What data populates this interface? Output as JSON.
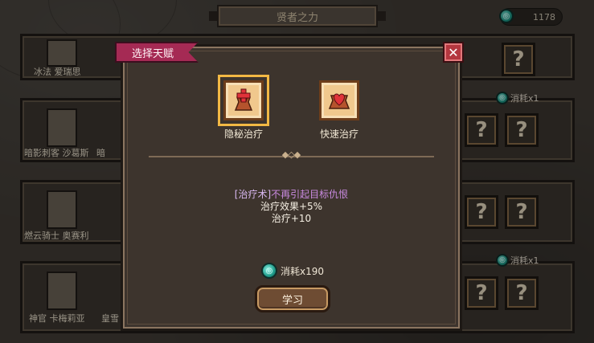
{
  "header": {
    "title": "贤者之力",
    "currency_amount": "1178",
    "currency_icon": "gem-icon"
  },
  "background_rows": [
    {
      "name": "冰法 爱瑞思",
      "extra_label": "",
      "cost": ""
    },
    {
      "name": "暗影刺客 沙葛斯",
      "extra_label": "暗",
      "cost": "消耗x1"
    },
    {
      "name": "燃云骑士 奥赛利",
      "extra_label": "",
      "cost": ""
    },
    {
      "name": "神官 卡梅莉亚",
      "extra_label": "皇雪",
      "cost": "消耗x1"
    }
  ],
  "slot_mark": "?",
  "modal": {
    "tag": "选择天赋",
    "close_glyph": "✕",
    "talents": [
      {
        "label": "隐秘治疗",
        "selected": true,
        "icon": "healing-hands-icon"
      },
      {
        "label": "快速治疗",
        "selected": false,
        "icon": "heart-hands-icon"
      }
    ],
    "description": {
      "tag": "[治疗术]",
      "effect": "不再引起目标仇恨",
      "line2": "治疗效果+5%",
      "line3": "治疗+10"
    },
    "cost": "消耗x190",
    "learn_button": "学习"
  },
  "colors": {
    "accent_tag": "#a52a54",
    "close": "#b4373f",
    "gem": "#1f9c8a",
    "selection": "#f2b844"
  }
}
